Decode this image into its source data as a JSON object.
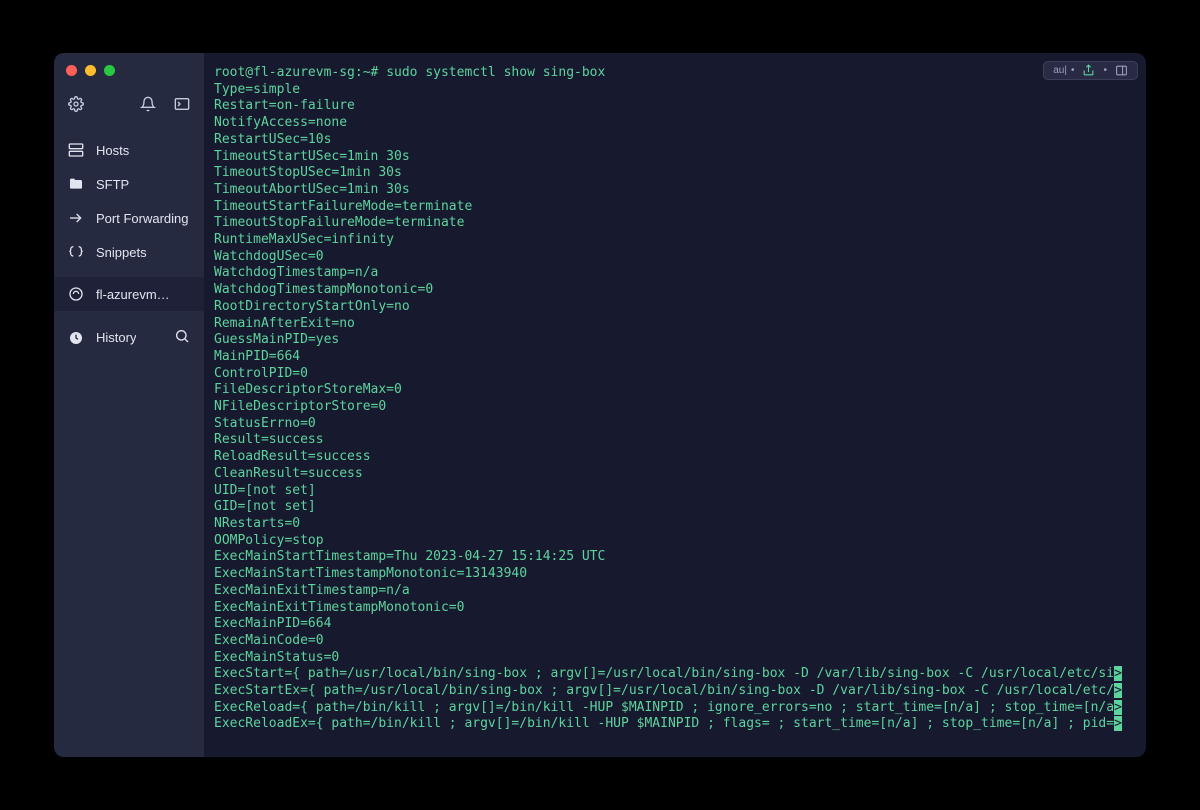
{
  "sidebar": {
    "items": [
      {
        "label": "Hosts"
      },
      {
        "label": "SFTP"
      },
      {
        "label": "Port Forwarding"
      },
      {
        "label": "Snippets"
      },
      {
        "label": "fl-azurevm…"
      },
      {
        "label": "History"
      }
    ]
  },
  "topbar": {
    "label_short": "au|"
  },
  "terminal": {
    "prompt": "root@fl-azurevm-sg:~#",
    "command": "sudo systemctl show sing-box",
    "lines": [
      "Type=simple",
      "Restart=on-failure",
      "NotifyAccess=none",
      "RestartUSec=10s",
      "TimeoutStartUSec=1min 30s",
      "TimeoutStopUSec=1min 30s",
      "TimeoutAbortUSec=1min 30s",
      "TimeoutStartFailureMode=terminate",
      "TimeoutStopFailureMode=terminate",
      "RuntimeMaxUSec=infinity",
      "WatchdogUSec=0",
      "WatchdogTimestamp=n/a",
      "WatchdogTimestampMonotonic=0",
      "RootDirectoryStartOnly=no",
      "RemainAfterExit=no",
      "GuessMainPID=yes",
      "MainPID=664",
      "ControlPID=0",
      "FileDescriptorStoreMax=0",
      "NFileDescriptorStore=0",
      "StatusErrno=0",
      "Result=success",
      "ReloadResult=success",
      "CleanResult=success",
      "UID=[not set]",
      "GID=[not set]",
      "NRestarts=0",
      "OOMPolicy=stop",
      "ExecMainStartTimestamp=Thu 2023-04-27 15:14:25 UTC",
      "ExecMainStartTimestampMonotonic=13143940",
      "ExecMainExitTimestamp=n/a",
      "ExecMainExitTimestampMonotonic=0",
      "ExecMainPID=664",
      "ExecMainCode=0",
      "ExecMainStatus=0"
    ],
    "long_lines": [
      "ExecStart={ path=/usr/local/bin/sing-box ; argv[]=/usr/local/bin/sing-box -D /var/lib/sing-box -C /usr/local/etc/si",
      "ExecStartEx={ path=/usr/local/bin/sing-box ; argv[]=/usr/local/bin/sing-box -D /var/lib/sing-box -C /usr/local/etc/",
      "ExecReload={ path=/bin/kill ; argv[]=/bin/kill -HUP $MAINPID ; ignore_errors=no ; start_time=[n/a] ; stop_time=[n/a",
      "ExecReloadEx={ path=/bin/kill ; argv[]=/bin/kill -HUP $MAINPID ; flags= ; start_time=[n/a] ; stop_time=[n/a] ; pid="
    ],
    "wrap_char": ">"
  }
}
